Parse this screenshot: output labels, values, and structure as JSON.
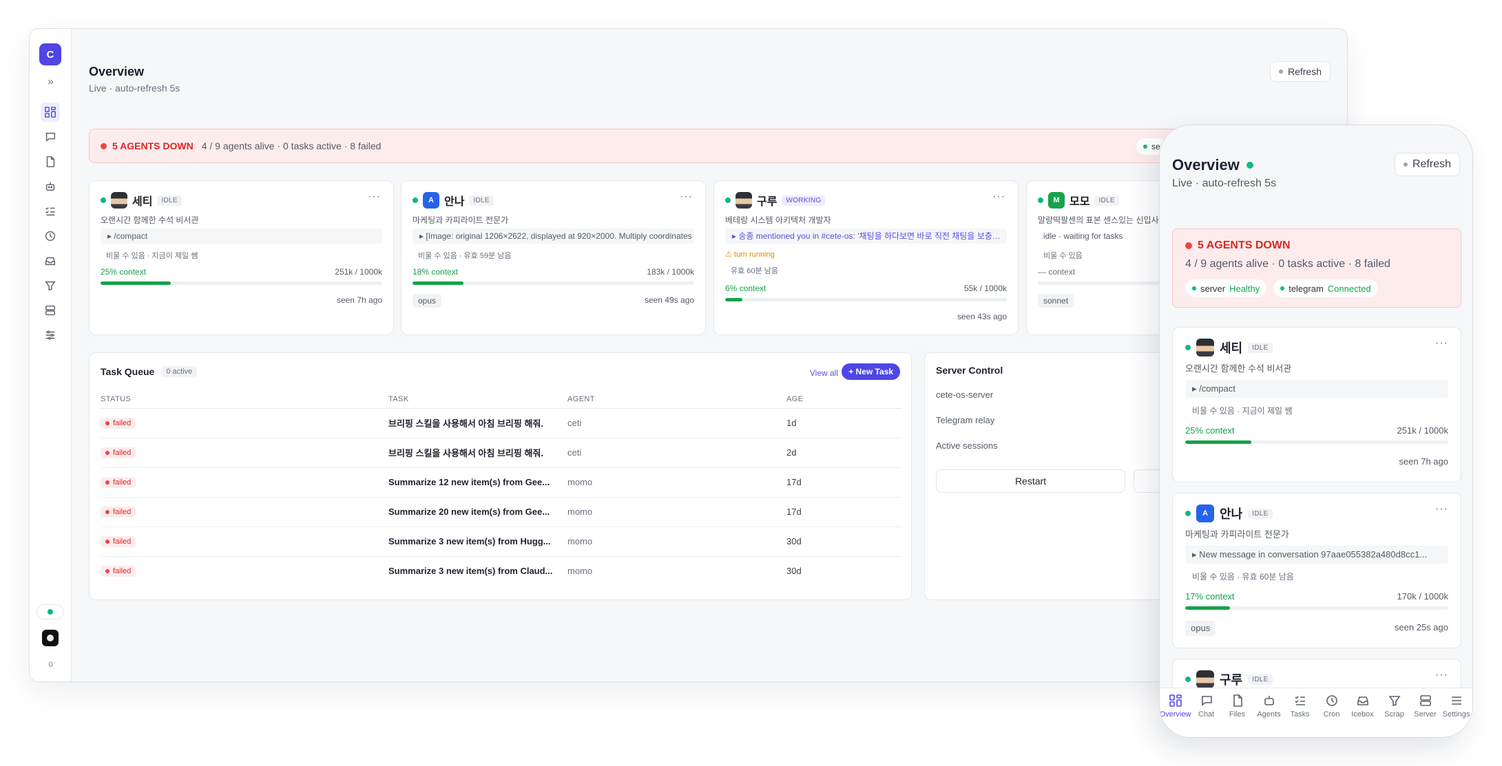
{
  "app": {
    "logo_letter": "C",
    "expand": "»",
    "rail_count": "0"
  },
  "header": {
    "title": "Overview",
    "subtitle": "Live · auto-refresh 5s",
    "refresh": "Refresh"
  },
  "alert": {
    "title": "5 AGENTS DOWN",
    "summary": "4 / 9 agents alive · 0 tasks active · 8 failed",
    "chip_clipped": "se"
  },
  "agents": [
    {
      "name": "세티",
      "status": "IDLE",
      "desc": "오랜시간 함께한 수석 비서관",
      "cmd": "▸ /compact",
      "meta": "비울 수 있음 · 지금이 제일 쌤",
      "ctx_label": "25% context",
      "ctx_pct": 25,
      "tokens": "251k / 1000k",
      "model": "",
      "seen": "seen 7h ago"
    },
    {
      "name": "안나",
      "initial": "A",
      "status": "IDLE",
      "desc": "마케팅과 카피라이트 전문가",
      "cmd": "▸ [Image: original 1206×2622, displayed at 920×2000. Multiply coordinates",
      "meta": "비울 수 있음 · 유효 59분 남음",
      "ctx_label": "18% context",
      "ctx_pct": 18,
      "tokens": "183k / 1000k",
      "model": "opus",
      "seen": "seen 49s ago"
    },
    {
      "name": "구루",
      "status": "WORKING",
      "desc": "베테랑 시스템 아키텍처 개발자",
      "cmd": "▸ 송종 mentioned you in #cete-os: '채팅을 하다보면 바로 직전 채팅을 보충하려고",
      "warn": "⚠ turn running",
      "meta": "유효 60분 남음",
      "ctx_label": "6% context",
      "ctx_pct": 6,
      "tokens": "55k / 1000k",
      "model": "",
      "seen": "seen 43s ago"
    },
    {
      "name": "모모",
      "initial": "M",
      "status": "IDLE",
      "desc": "말랑떡팔센의 표본 센스있는 신입사원",
      "cmd": "idle · waiting for tasks",
      "meta": "비울 수 있음",
      "ctx_label": "— context",
      "ctx_pct": 0,
      "tokens": "",
      "model": "sonnet",
      "seen": ""
    }
  ],
  "task_queue": {
    "title": "Task Queue",
    "count": "0 active",
    "view_all": "View all",
    "new_task": "+ New Task",
    "columns": [
      "STATUS",
      "TASK",
      "AGENT",
      "AGE"
    ],
    "rows": [
      {
        "status": "failed",
        "task": "브리핑 스킬을 사용해서 아침 브리핑 해줘.",
        "agent": "ceti",
        "age": "1d"
      },
      {
        "status": "failed",
        "task": "브리핑 스킬을 사용해서 아침 브리핑 해줘.",
        "agent": "ceti",
        "age": "2d"
      },
      {
        "status": "failed",
        "task": "Summarize 12 new item(s) from Gee...",
        "agent": "momo",
        "age": "17d"
      },
      {
        "status": "failed",
        "task": "Summarize 20 new item(s) from Gee...",
        "agent": "momo",
        "age": "17d"
      },
      {
        "status": "failed",
        "task": "Summarize 3 new item(s) from Hugg...",
        "agent": "momo",
        "age": "30d"
      },
      {
        "status": "failed",
        "task": "Summarize 3 new item(s) from Claud...",
        "agent": "momo",
        "age": "30d"
      }
    ]
  },
  "server_control": {
    "title": "Server Control",
    "rows": [
      "cete-os-server",
      "Telegram relay",
      "Active sessions"
    ],
    "restart": "Restart"
  },
  "mobile": {
    "title": "Overview",
    "subtitle": "Live · auto-refresh 5s",
    "refresh": "Refresh",
    "alert_title": "5 AGENTS DOWN",
    "alert_summary": "4 / 9 agents alive · 0 tasks active · 8 failed",
    "chips": [
      {
        "name": "server",
        "state": "Healthy"
      },
      {
        "name": "telegram",
        "state": "Connected"
      }
    ],
    "agents": [
      {
        "name": "세티",
        "status": "IDLE",
        "desc": "오랜시간 함께한 수석 비서관",
        "cmd": "▸ /compact",
        "meta": "비울 수 있음 · 지금이 제일 쌤",
        "ctx_label": "25% context",
        "ctx_pct": 25,
        "tokens": "251k / 1000k",
        "model": "",
        "seen": "seen 7h ago"
      },
      {
        "name": "안나",
        "initial": "A",
        "status": "IDLE",
        "desc": "마케팅과 카피라이트 전문가",
        "cmd": "▸ New message in conversation 97aae055382a480d8cc1...",
        "meta": "비울 수 있음 · 유효 60분 남음",
        "ctx_label": "17% context",
        "ctx_pct": 17,
        "tokens": "170k / 1000k",
        "model": "opus",
        "seen": "seen 25s ago"
      },
      {
        "name": "구루",
        "status": "IDLE"
      }
    ],
    "tabs": [
      "Overview",
      "Chat",
      "Files",
      "Agents",
      "Tasks",
      "Cron",
      "Icebox",
      "Scrap",
      "Server",
      "Settings"
    ]
  },
  "colors": {
    "accent": "#4f46e5",
    "alive": "#10b981",
    "danger": "#dc2626",
    "context": "#16a34a"
  }
}
